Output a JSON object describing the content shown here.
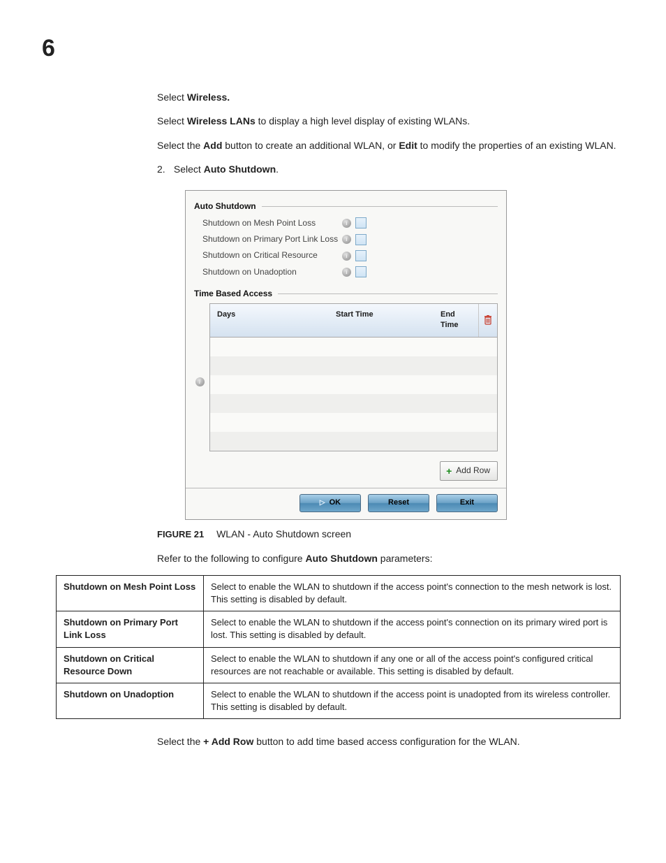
{
  "page_number": "6",
  "intro": {
    "line1_a": "Select ",
    "line1_b": "Wireless.",
    "line2_a": "Select ",
    "line2_b": "Wireless LANs",
    "line2_c": " to display a high level display of existing WLANs.",
    "line3_a": "Select the ",
    "line3_b": "Add",
    "line3_c": " button to create an additional WLAN, or ",
    "line3_d": "Edit",
    "line3_e": " to modify the properties of an existing WLAN.",
    "step_num": "2.",
    "step_a": "Select ",
    "step_b": "Auto Shutdown",
    "step_c": "."
  },
  "panel": {
    "section1": "Auto Shutdown",
    "opts": [
      "Shutdown on Mesh Point Loss",
      "Shutdown on Primary Port Link Loss",
      "Shutdown on Critical Resource",
      "Shutdown on Unadoption"
    ],
    "section2": "Time Based Access",
    "headers": {
      "days": "Days",
      "start": "Start Time",
      "end": "End Time"
    },
    "addrow": "Add Row",
    "buttons": {
      "ok": "OK",
      "reset": "Reset",
      "exit": "Exit"
    }
  },
  "figure": {
    "label": "FIGURE 21",
    "caption": "WLAN - Auto Shutdown screen"
  },
  "refer_a": "Refer to the following to configure ",
  "refer_b": "Auto Shutdown",
  "refer_c": " parameters:",
  "params": [
    {
      "name": "Shutdown on Mesh Point Loss",
      "desc": "Select to enable the WLAN to shutdown if the access point's connection to the mesh network is lost. This setting is disabled by default."
    },
    {
      "name": "Shutdown on Primary Port Link Loss",
      "desc": "Select to enable the WLAN to shutdown if the access point's connection on its primary wired port is lost. This setting is disabled by default."
    },
    {
      "name": "Shutdown on Critical Resource Down",
      "desc": "Select to enable the WLAN to shutdown if any one or all of the access point's configured critical resources are not reachable or available. This setting is disabled by default."
    },
    {
      "name": "Shutdown on Unadoption",
      "desc": "Select to enable the WLAN to shutdown if the access point is unadopted from its wireless controller. This setting is disabled by default."
    }
  ],
  "final_a": "Select the ",
  "final_b": "+ Add Row",
  "final_c": " button to add time based access configuration for the WLAN."
}
